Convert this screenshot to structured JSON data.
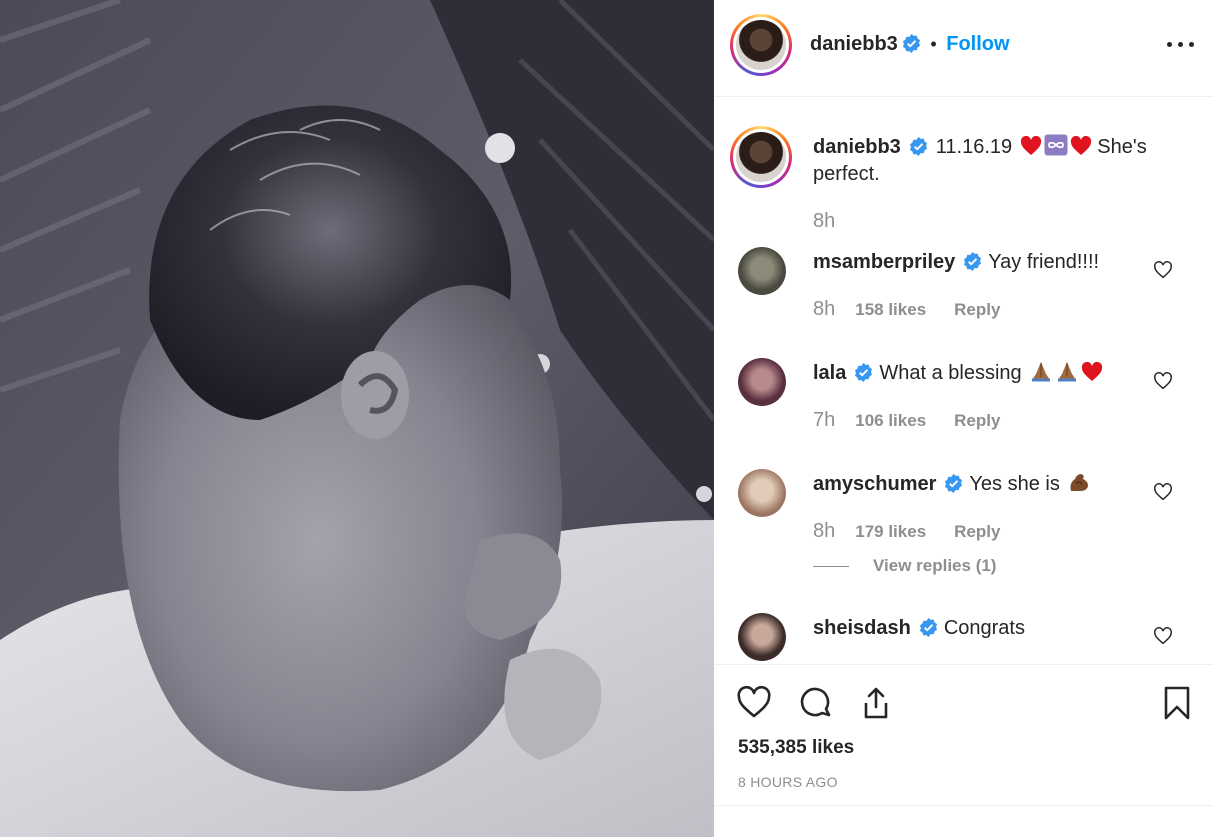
{
  "post_author": {
    "username": "daniebb3",
    "follow_label": "Follow",
    "separator": "•"
  },
  "caption": {
    "username": "daniebb3",
    "text_before": "11.16.19",
    "text_after": "She's perfect.",
    "time": "8h"
  },
  "comments": [
    {
      "username": "msamberpriley",
      "text": "Yay friend!!!!",
      "time": "8h",
      "likes": "158 likes",
      "reply": "Reply",
      "avatar_color": "#6b6b5a"
    },
    {
      "username": "lala",
      "text": "What a blessing",
      "time": "7h",
      "likes": "106 likes",
      "reply": "Reply",
      "avatar_color": "#7a4f58"
    },
    {
      "username": "amyschumer",
      "text": "Yes she is",
      "time": "8h",
      "likes": "179 likes",
      "reply": "Reply",
      "avatar_color": "#c9a08a"
    },
    {
      "username": "sheisdash",
      "text": "Congrats",
      "time": "",
      "likes": "",
      "reply": "",
      "avatar_color": "#5a4a44"
    }
  ],
  "view_replies": "View replies (1)",
  "footer": {
    "likes": "535,385 likes",
    "timestamp": "8 HOURS AGO"
  },
  "icons": {
    "like": "heart-icon",
    "comment": "comment-icon",
    "share": "share-icon",
    "save": "bookmark-icon",
    "more": "more-options-icon",
    "verified": "verified-badge-icon"
  },
  "colors": {
    "link_blue": "#0095f6",
    "verified_blue": "#3897f0",
    "text": "#262626",
    "muted": "#8e8e8e",
    "divider": "#efefef"
  }
}
